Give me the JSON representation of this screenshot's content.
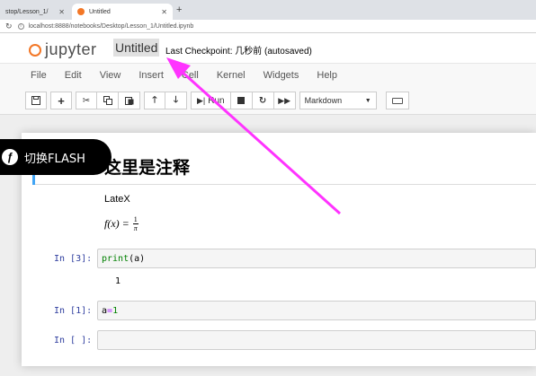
{
  "browser": {
    "tabs": [
      {
        "title": "stop/Lesson_1/",
        "active": false
      },
      {
        "title": "Untitled",
        "active": true
      }
    ],
    "new_tab": "+",
    "url": "localhost:8888/notebooks/Desktop/Lesson_1/Untitled.ipynb"
  },
  "header": {
    "logo_text": "jupyter",
    "notebook_name": "Untitled",
    "checkpoint": "Last Checkpoint: 几秒前  (autosaved)"
  },
  "menu": {
    "items": [
      "File",
      "Edit",
      "View",
      "Insert",
      "Cell",
      "Kernel",
      "Widgets",
      "Help"
    ]
  },
  "toolbar": {
    "run_label": "Run",
    "cell_type": "Markdown"
  },
  "cells": {
    "heading": "这里是注释",
    "latex_label": "LateX",
    "formula_lhs": "f(x) = ",
    "formula_num": "1",
    "formula_den": "π",
    "cell1": {
      "prompt": "In  [3]:",
      "code_fn": "print",
      "code_rest": "(a)",
      "output": "1"
    },
    "cell2": {
      "prompt": "In  [1]:",
      "code_var": "a ",
      "code_op": "=",
      "code_val": " 1"
    },
    "cell3": {
      "prompt": "In  [ ]:"
    }
  },
  "overlay": {
    "label": "切换FLASH",
    "icon": "flash-icon"
  },
  "colors": {
    "arrow": "#ff33ff",
    "jupyter_orange": "#f37726",
    "prompt": "#303f9f",
    "selected_cell": "#42a5f5"
  }
}
